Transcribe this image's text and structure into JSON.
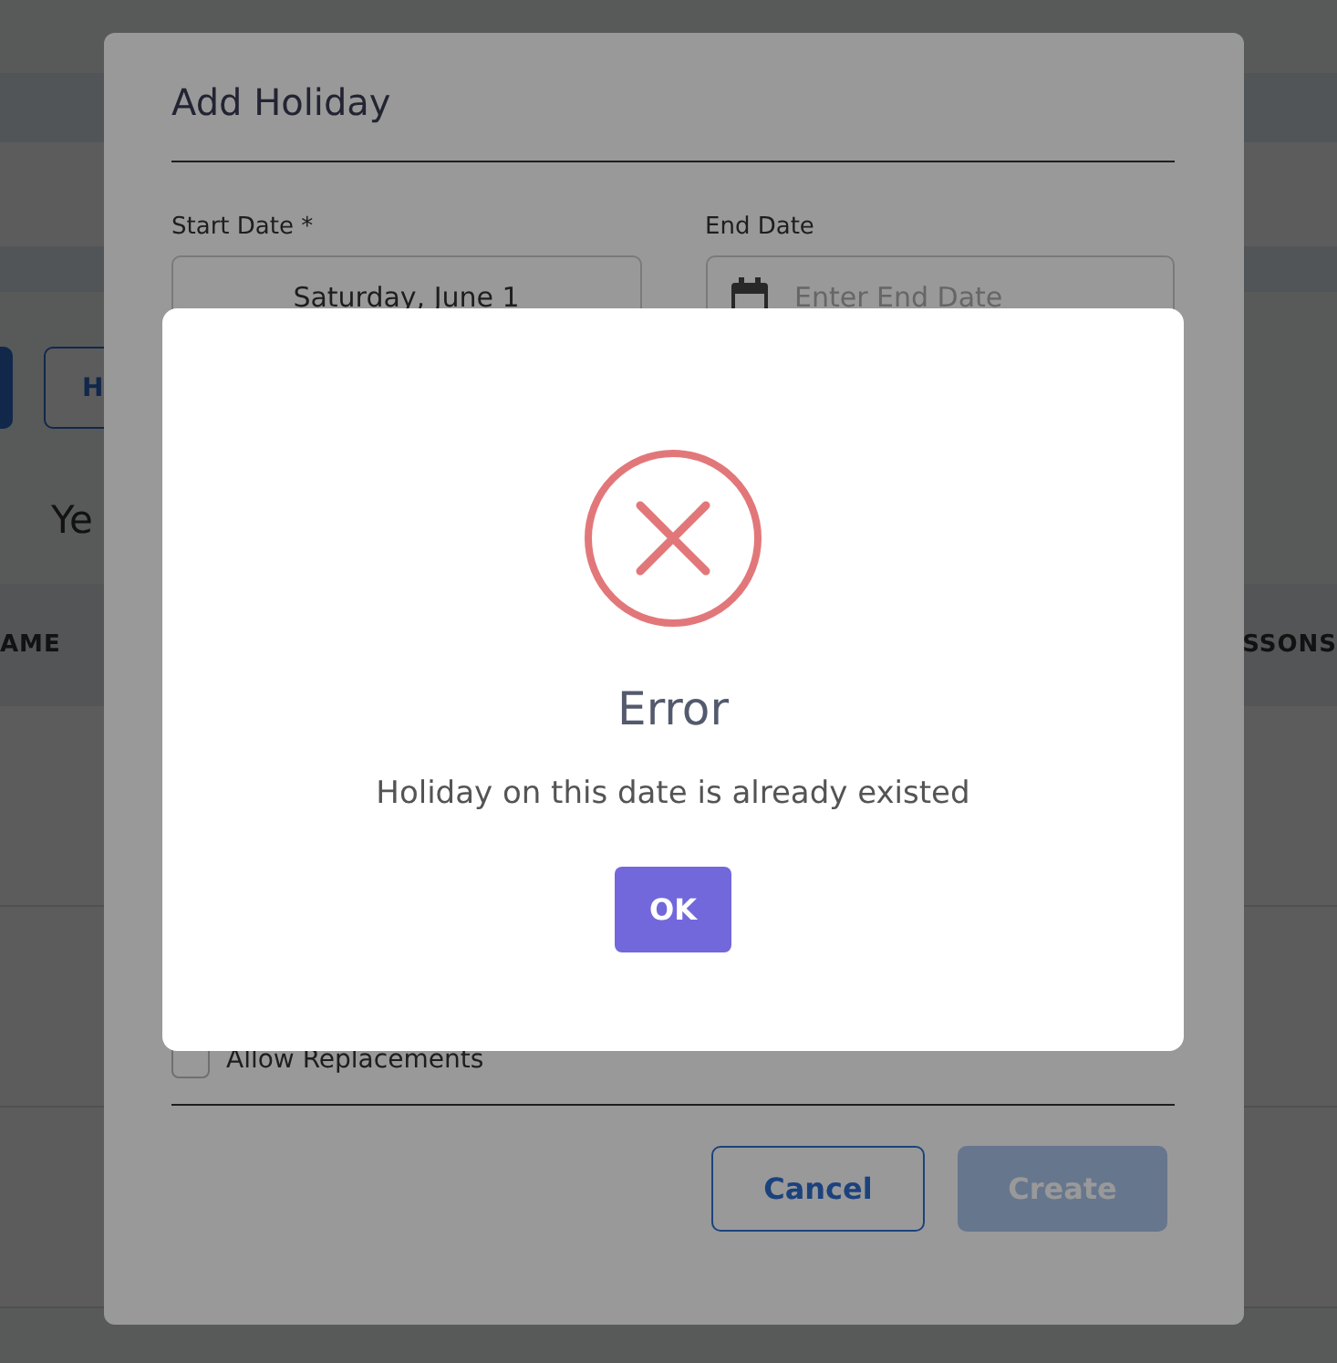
{
  "background_page": {
    "buttons": [
      {
        "kind": "filled"
      },
      {
        "label": "H",
        "kind": "outline"
      }
    ],
    "heading": "Ye",
    "table": {
      "columns": [
        "AME",
        "SSONS"
      ]
    }
  },
  "modal": {
    "title": "Add Holiday",
    "fields": [
      {
        "kind": "date",
        "label": "Start Date *",
        "value": "Saturday, June 1"
      },
      {
        "kind": "date_icon",
        "label": "End Date",
        "placeholder": "Enter End Date"
      }
    ],
    "checkbox": {
      "label": "Allow Replacements",
      "checked": false
    },
    "buttons": [
      {
        "kind": "outline",
        "label": "Cancel",
        "disabled": false
      },
      {
        "kind": "filled",
        "label": "Create",
        "disabled": true
      }
    ]
  },
  "error_dialog": {
    "title": "Error",
    "message": "Holiday on this date is already existed",
    "button": "OK"
  }
}
